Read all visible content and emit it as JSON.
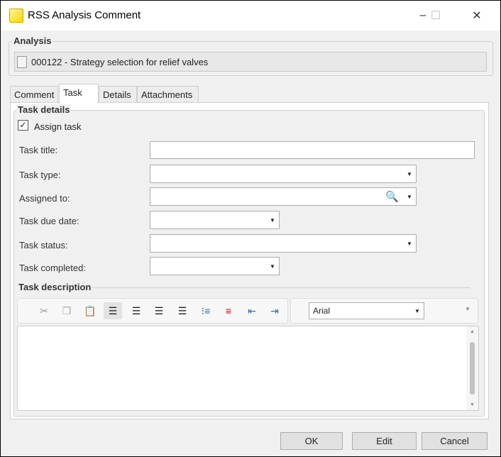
{
  "window": {
    "title": "RSS Analysis Comment",
    "minimize": "–",
    "maximize": "☐",
    "close": "✕"
  },
  "analysis": {
    "label": "Analysis",
    "value": "000122 - Strategy selection for relief valves"
  },
  "tabs": [
    {
      "label": "Comment"
    },
    {
      "label": "Task"
    },
    {
      "label": "Details"
    },
    {
      "label": "Attachments"
    }
  ],
  "task": {
    "group_label": "Task details",
    "assign_label": "Assign task",
    "assign_checked": true,
    "fields": [
      {
        "label": "Task title:",
        "value": ""
      },
      {
        "label": "Task type:",
        "value": ""
      },
      {
        "label": "Assigned to:",
        "value": ""
      },
      {
        "label": "Task due date:",
        "value": ""
      },
      {
        "label": "Task status:",
        "value": ""
      },
      {
        "label": "Task completed:",
        "value": ""
      }
    ],
    "description_label": "Task description",
    "font": "Arial",
    "description": ""
  },
  "buttons": {
    "ok": "OK",
    "edit": "Edit",
    "cancel": "Cancel"
  }
}
